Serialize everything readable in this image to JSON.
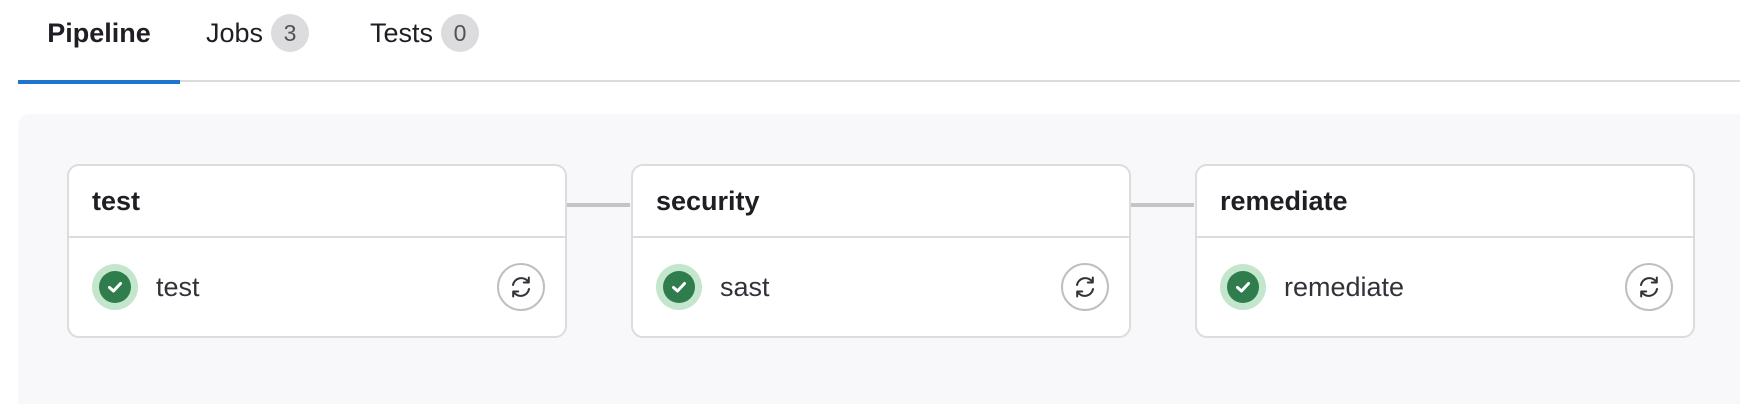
{
  "tabs": [
    {
      "label": "Pipeline",
      "active": true
    },
    {
      "label": "Jobs",
      "count": "3"
    },
    {
      "label": "Tests",
      "count": "0"
    }
  ],
  "stages": [
    {
      "name": "test",
      "job": {
        "name": "test",
        "status": "success",
        "icon": "check-circle-icon",
        "action": "retry-icon"
      }
    },
    {
      "name": "security",
      "job": {
        "name": "sast",
        "status": "success",
        "icon": "check-circle-icon",
        "action": "retry-icon"
      }
    },
    {
      "name": "remediate",
      "job": {
        "name": "remediate",
        "status": "success",
        "icon": "check-circle-icon",
        "action": "retry-icon"
      }
    }
  ],
  "colors": {
    "accent": "#1f75cb",
    "success": "#2f7d4c",
    "success_bg": "#c3e6cd",
    "border": "#dcdcde",
    "canvas_bg": "#f8f8fa"
  }
}
